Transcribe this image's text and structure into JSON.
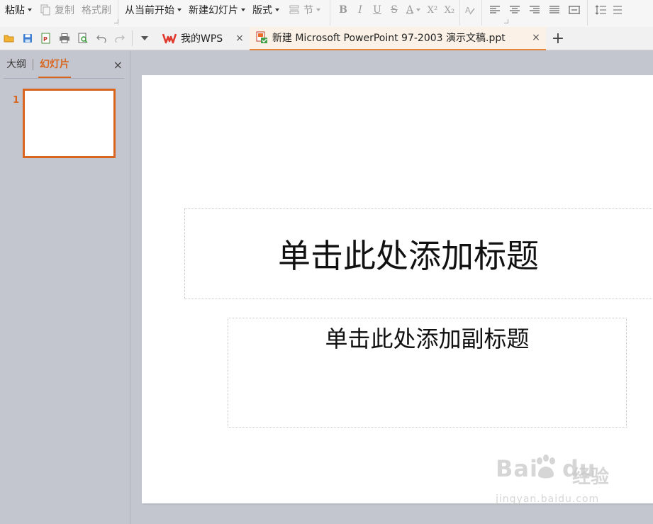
{
  "ribbon": {
    "paste": "粘贴",
    "copy": "复制",
    "format_painter": "格式刷",
    "from_current": "从当前开始",
    "new_slide": "新建幻灯片",
    "layout": "版式",
    "section": "节",
    "bold": "B",
    "italic": "I",
    "underline": "U",
    "strike": "S",
    "font_color": "A",
    "superscript": "X²",
    "subscript": "X₂"
  },
  "tabs": [
    {
      "label": "我的WPS",
      "close": "×",
      "icon": "wps-logo-icon"
    },
    {
      "label": "新建 Microsoft PowerPoint 97-2003 演示文稿.ppt",
      "close": "×",
      "icon": "ppt-file-icon",
      "active": true
    }
  ],
  "new_tab": "+",
  "left_panel": {
    "tab_outline": "大纲",
    "tab_slides": "幻灯片",
    "close": "×",
    "slide_number": "1"
  },
  "slide": {
    "title_placeholder": "单击此处添加标题",
    "subtitle_placeholder": "单击此处添加副标题"
  },
  "watermark": {
    "brand": "Bai",
    "brand2": "du",
    "cn": "经验",
    "url": "jingyan.baidu.com"
  },
  "colors": {
    "accent": "#d9661f",
    "wps_red": "#e03a2f",
    "panel_bg": "#c3c6cf"
  }
}
